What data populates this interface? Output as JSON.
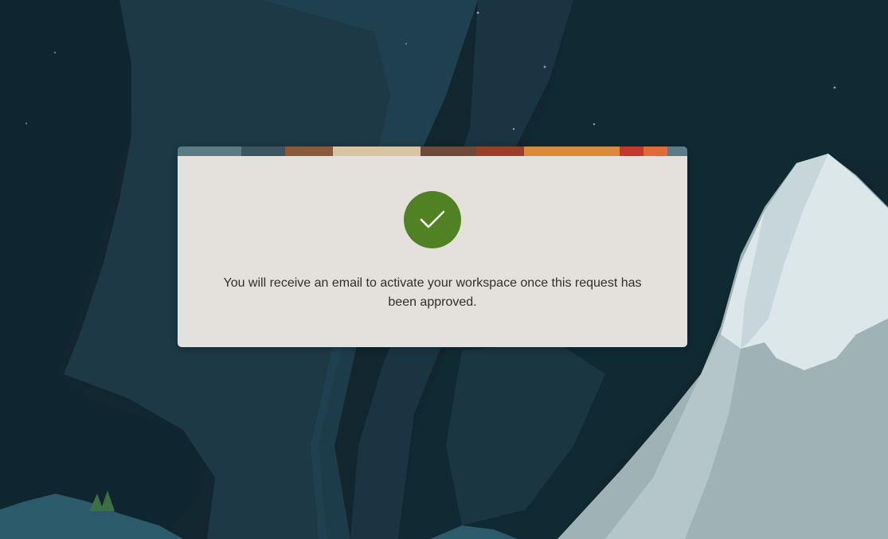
{
  "confirmation": {
    "icon": "checkmark-icon",
    "message": "You will receive an email to activate your workspace once this request has been approved."
  },
  "colors": {
    "background": "#10262f",
    "card": "#e4e1dd",
    "success": "#508223",
    "text": "#312d2a"
  }
}
